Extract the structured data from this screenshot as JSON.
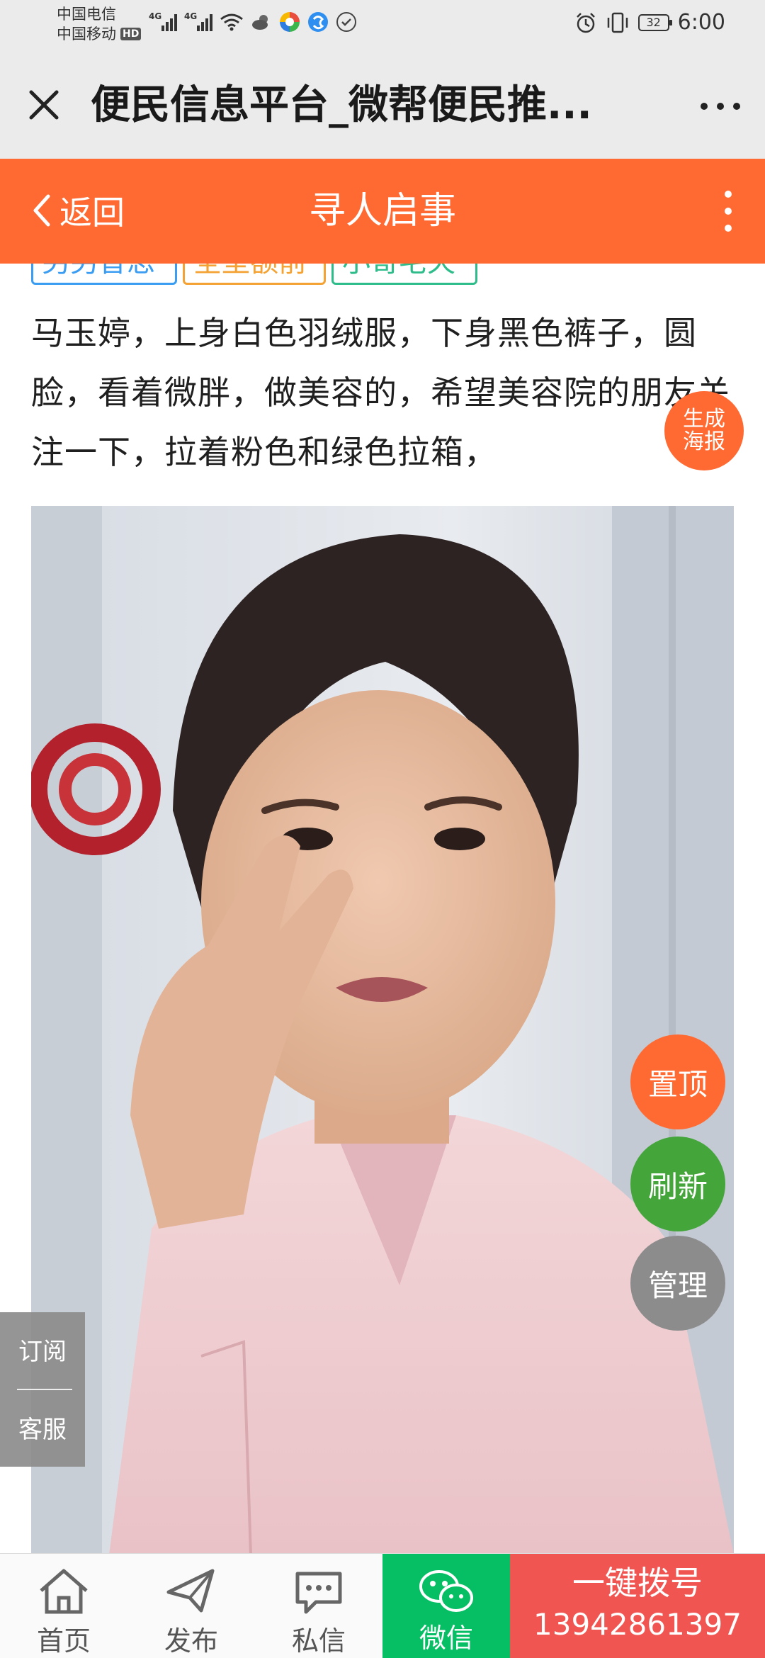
{
  "status_bar": {
    "carrier1": "中国电信",
    "carrier2": "中国移动",
    "hd": "HD",
    "net1": "4G",
    "net2": "4G",
    "battery": "32",
    "time": "6:00"
  },
  "title_bar": {
    "title": "便民信息平台_微帮便民推..."
  },
  "header": {
    "back_label": "返回",
    "title": "寻人启事"
  },
  "tags": [
    "另另智思",
    "全型额前",
    "小哥宅天"
  ],
  "content": {
    "text": "马玉婷，上身白色羽绒服，下身黑色裤子，圆脸，看着微胖，做美容的，希望美容院的朋友关注一下，拉着粉色和绿色拉箱，"
  },
  "floating": {
    "poster_line1": "生成",
    "poster_line2": "海报",
    "top": "置顶",
    "refresh": "刷新",
    "manage": "管理",
    "subscribe": "订阅",
    "service": "客服"
  },
  "bottom_nav": {
    "home": "首页",
    "publish": "发布",
    "message": "私信",
    "wechat": "微信",
    "call_label": "一键拨号",
    "phone": "13942861397"
  },
  "colors": {
    "accent_orange": "#ff6a33",
    "green": "#44a53b",
    "wechat_green": "#06be64",
    "call_red": "#f15552"
  }
}
